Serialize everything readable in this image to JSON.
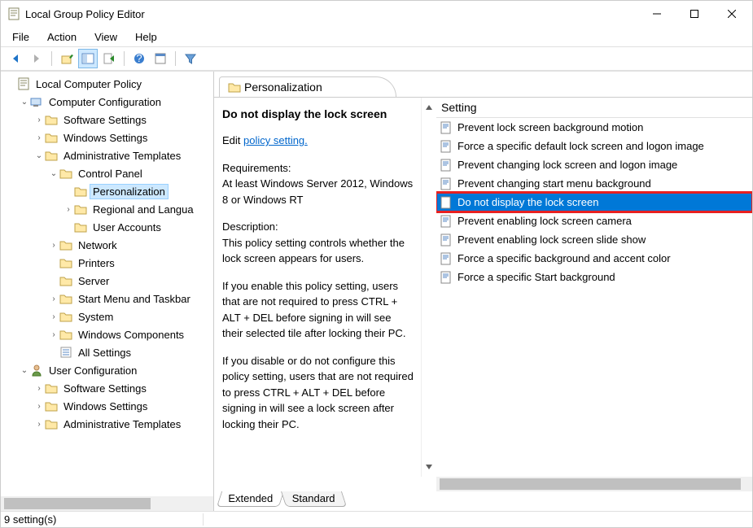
{
  "window": {
    "title": "Local Group Policy Editor"
  },
  "menu": {
    "file": "File",
    "action": "Action",
    "view": "View",
    "help": "Help"
  },
  "tree": {
    "root": "Local Computer Policy",
    "cc": "Computer Configuration",
    "cc_sw": "Software Settings",
    "cc_win": "Windows Settings",
    "cc_adm": "Administrative Templates",
    "cp": "Control Panel",
    "cp_pers": "Personalization",
    "cp_reg": "Regional and Langua",
    "cp_usr": "User Accounts",
    "net": "Network",
    "prn": "Printers",
    "srv": "Server",
    "stm": "Start Menu and Taskbar",
    "sys": "System",
    "wc": "Windows Components",
    "allset": "All Settings",
    "uc": "User Configuration",
    "uc_sw": "Software Settings",
    "uc_win": "Windows Settings",
    "uc_adm": "Administrative Templates"
  },
  "pane": {
    "header": "Personalization",
    "detail_title": "Do not display the lock screen",
    "edit_prefix": "Edit ",
    "edit_link": "policy setting.",
    "req_label": "Requirements:",
    "req_text": "At least Windows Server 2012, Windows 8 or Windows RT",
    "desc_label": "Description:",
    "desc_p1": "This policy setting controls whether the lock screen appears for users.",
    "desc_p2": "If you enable this policy setting, users that are not required to press CTRL + ALT + DEL before signing in will see their selected tile after locking their PC.",
    "desc_p3": "If you disable or do not configure this policy setting, users that are not required to press CTRL + ALT + DEL before signing in will see a lock screen after locking their PC.",
    "col_setting": "Setting",
    "settings": [
      "Prevent lock screen background motion",
      "Force a specific default lock screen and logon image",
      "Prevent changing lock screen and logon image",
      "Prevent changing start menu background",
      "Do not display the lock screen",
      "Prevent enabling lock screen camera",
      "Prevent enabling lock screen slide show",
      "Force a specific background and accent color",
      "Force a specific Start background"
    ],
    "selected_index": 4,
    "tabs": {
      "ext": "Extended",
      "std": "Standard"
    }
  },
  "status": {
    "text": "9 setting(s)"
  }
}
